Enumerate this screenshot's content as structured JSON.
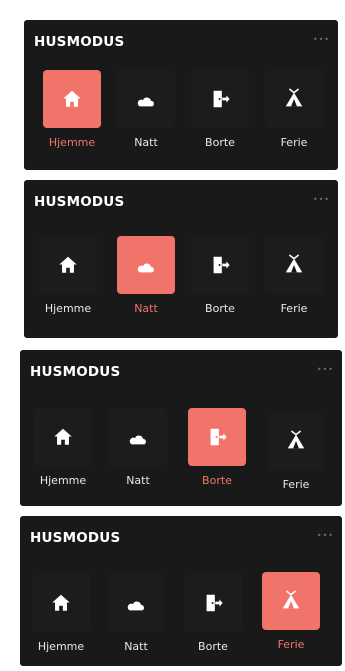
{
  "panels": [
    {
      "title": "HUSMODUS",
      "menu_icon": "more-dots-icon",
      "active_mode": "hjemme",
      "modes": [
        {
          "id": "hjemme",
          "label": "Hjemme",
          "icon": "home-icon"
        },
        {
          "id": "natt",
          "label": "Natt",
          "icon": "moon-cloud-icon"
        },
        {
          "id": "borte",
          "label": "Borte",
          "icon": "door-exit-icon"
        },
        {
          "id": "ferie",
          "label": "Ferie",
          "icon": "tent-icon"
        }
      ]
    },
    {
      "title": "HUSMODUS",
      "menu_icon": "more-dots-icon",
      "active_mode": "natt",
      "modes": [
        {
          "id": "hjemme",
          "label": "Hjemme",
          "icon": "home-icon"
        },
        {
          "id": "natt",
          "label": "Natt",
          "icon": "moon-cloud-icon"
        },
        {
          "id": "borte",
          "label": "Borte",
          "icon": "door-exit-icon"
        },
        {
          "id": "ferie",
          "label": "Ferie",
          "icon": "tent-icon"
        }
      ]
    },
    {
      "title": "HUSMODUS",
      "menu_icon": "more-dots-icon",
      "active_mode": "borte",
      "modes": [
        {
          "id": "hjemme",
          "label": "Hjemme",
          "icon": "home-icon"
        },
        {
          "id": "natt",
          "label": "Natt",
          "icon": "moon-cloud-icon"
        },
        {
          "id": "borte",
          "label": "Borte",
          "icon": "door-exit-icon"
        },
        {
          "id": "ferie",
          "label": "Ferie",
          "icon": "tent-icon"
        }
      ]
    },
    {
      "title": "HUSMODUS",
      "menu_icon": "more-dots-icon",
      "active_mode": "ferie",
      "modes": [
        {
          "id": "hjemme",
          "label": "Hjemme",
          "icon": "home-icon"
        },
        {
          "id": "natt",
          "label": "Natt",
          "icon": "moon-cloud-icon"
        },
        {
          "id": "borte",
          "label": "Borte",
          "icon": "door-exit-icon"
        },
        {
          "id": "ferie",
          "label": "Ferie",
          "icon": "tent-icon"
        }
      ]
    }
  ],
  "colors": {
    "panel_background": "#191919",
    "button_background": "#1c1c1c",
    "active_accent": "#f0746a",
    "icon": "#ffffff",
    "label": "#e8e8e8",
    "page_background": "#ffffff"
  }
}
